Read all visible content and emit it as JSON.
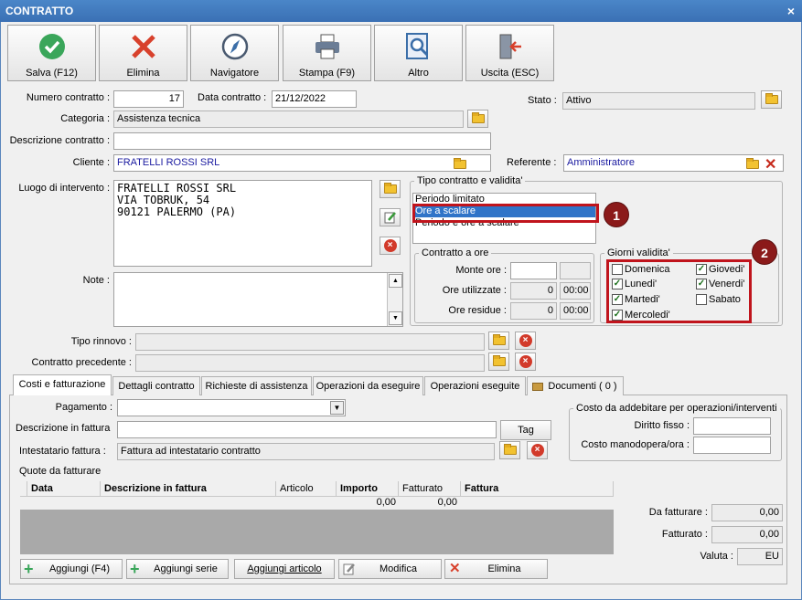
{
  "window": {
    "title": "CONTRATTO",
    "close": "×"
  },
  "toolbar": [
    {
      "label": "Salva (F12)",
      "icon": "check-icon"
    },
    {
      "label": "Elimina",
      "icon": "delete-x-icon"
    },
    {
      "label": "Navigatore",
      "icon": "compass-icon"
    },
    {
      "label": "Stampa (F9)",
      "icon": "printer-icon"
    },
    {
      "label": "Altro",
      "icon": "magnifier-icon"
    },
    {
      "label": "Uscita (ESC)",
      "icon": "exit-door-icon"
    }
  ],
  "form": {
    "numero_label": "Numero contratto :",
    "numero": "17",
    "data_label": "Data contratto :",
    "data": "21/12/2022",
    "stato_label": "Stato :",
    "stato": "Attivo",
    "categoria_label": "Categoria :",
    "categoria": "Assistenza tecnica",
    "descrizione_label": "Descrizione contratto :",
    "descrizione": "",
    "cliente_label": "Cliente :",
    "cliente": "FRATELLI ROSSI SRL",
    "referente_label": "Referente :",
    "referente": "Amministratore",
    "luogo_label": "Luogo di intervento :",
    "luogo_lines": [
      "FRATELLI ROSSI SRL",
      "VIA TOBRUK, 54",
      "90121 PALERMO (PA)"
    ],
    "note_label": "Note :",
    "tipo_rinnovo_label": "Tipo rinnovo :",
    "contratto_prec_label": "Contratto precedente :"
  },
  "tipo_contratto": {
    "title": "Tipo contratto e validita'",
    "options": [
      "Periodo limitato",
      "Ore a scalare",
      "Periodo e ore a scalare"
    ],
    "selected": "Ore a scalare"
  },
  "contratto_ore": {
    "title": "Contratto a ore",
    "monte_label": "Monte ore :",
    "monte": "",
    "utilizzate_label": "Ore utilizzate :",
    "utilizzate": "0",
    "utilizzate_time": "00:00",
    "residue_label": "Ore residue :",
    "residue": "0",
    "residue_time": "00:00"
  },
  "giorni": {
    "title": "Giorni validita'",
    "days": [
      {
        "name": "Domenica",
        "checked": false
      },
      {
        "name": "Lunedi'",
        "checked": true
      },
      {
        "name": "Martedi'",
        "checked": true
      },
      {
        "name": "Mercoledi'",
        "checked": true
      },
      {
        "name": "Giovedi'",
        "checked": true
      },
      {
        "name": "Venerdi'",
        "checked": true
      },
      {
        "name": "Sabato",
        "checked": false
      }
    ]
  },
  "badges": [
    "1",
    "2"
  ],
  "tabs": [
    "Costi e fatturazione",
    "Dettagli contratto",
    "Richieste di assistenza",
    "Operazioni da eseguire",
    "Operazioni eseguite",
    "Documenti ( 0 )"
  ],
  "fatt": {
    "pagamento_label": "Pagamento :",
    "pagamento": "",
    "descr_label": "Descrizione in fattura",
    "descr": "",
    "tag_label": "Tag",
    "intestatario_label": "Intestatario fattura :",
    "intestatario": "Fattura ad intestatario contratto",
    "quote_label": "Quote da fatturare",
    "costo_title": "Costo da addebitare per operazioni/interventi",
    "diritto_label": "Diritto fisso :",
    "manodopera_label": "Costo manodopera/ora :"
  },
  "grid": {
    "columns": [
      "Data",
      "Descrizione in fattura",
      "Articolo",
      "Importo",
      "Fatturato",
      "Fattura"
    ],
    "totals": {
      "importo": "0,00",
      "fatturato": "0,00"
    }
  },
  "totals": {
    "da_fatturare_label": "Da fatturare :",
    "da_fatturare": "0,00",
    "fatturato_label": "Fatturato :",
    "fatturato": "0,00",
    "valuta_label": "Valuta :",
    "valuta": "EU"
  },
  "bottom_buttons": [
    "Aggiungi (F4)",
    "Aggiungi serie",
    "Aggiungi articolo",
    "Modifica",
    "Elimina"
  ],
  "colors": {
    "title_bar": "#3a70b4",
    "selection": "#3074c8",
    "highlight_border": "#c0141c",
    "badge": "#8b1a1a"
  }
}
